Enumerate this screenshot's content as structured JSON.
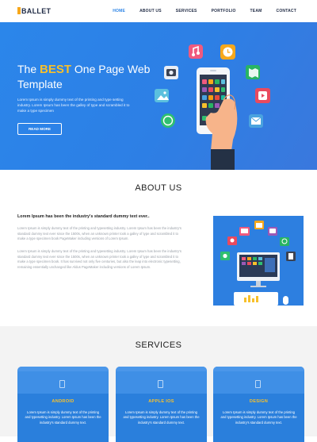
{
  "brand": {
    "name": "BALLET"
  },
  "nav": {
    "items": [
      {
        "label": "HOME",
        "active": true
      },
      {
        "label": "ABOUT US",
        "active": false
      },
      {
        "label": "SERVICES",
        "active": false
      },
      {
        "label": "PORTFOLIO",
        "active": false
      },
      {
        "label": "TEAM",
        "active": false
      },
      {
        "label": "CONTACT",
        "active": false
      }
    ]
  },
  "hero": {
    "title_pre": "The ",
    "title_highlight": "BEST",
    "title_post": " One Page Web Template",
    "text": "Lorem Ipsum is simply dummy text of the printing and type setting industry. Lorem Ipsum has been the galley of type and scrambled it to make a type specimen",
    "button": "READ MORE",
    "colors": {
      "accent": "#f7c02b",
      "background": "#2b86ea"
    }
  },
  "about": {
    "title": "ABOUT US",
    "lead": "Lorem Ipsum has been the industry's standard dummy text ever..",
    "paragraph1": "Lorem Ipsum is simply dummy text of the printing and typesetting industry. Lorem Ipsum has been the industry's standard dummy text ever since the 1500s, when an unknown printer took a galley of type and scrambled it to make a type specimen book PageMaker including versions of Lorem Ipsum.",
    "paragraph2": "Lorem Ipsum is simply dummy text of the printing and typesetting industry. Lorem Ipsum has been the industry's standard dummy text ever since the 1500s, when an unknown printer took a galley of type and scrambled it to make a type specimen book. It has survived not only five centuries, but also the leap into electronic typesetting, remaining essentially unchanged like Aldus PageMaker including versions of Lorem Ipsum."
  },
  "services": {
    "title": "SERVICES",
    "cards": [
      {
        "title": "ANDROID",
        "text": "Lorem Ipsum is simply dummy text of the printing and typesetting industry. Lorem Ipsum has been the industry's standard dummy text.",
        "icon": "mobile-icon"
      },
      {
        "title": "APPLE IOS",
        "text": "Lorem Ipsum is simply dummy text of the printing and typesetting industry. Lorem Ipsum has been the industry's standard dummy text.",
        "icon": "mobile-icon"
      },
      {
        "title": "DESIGN",
        "text": "Lorem Ipsum is simply dummy text of the printing and typesetting industry. Lorem Ipsum has been the industry's standard dummy text.",
        "icon": "mobile-icon"
      }
    ]
  }
}
